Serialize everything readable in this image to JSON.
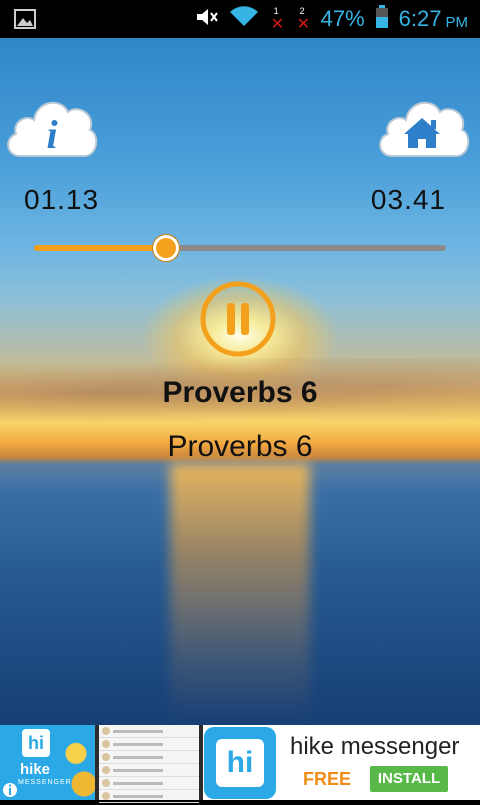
{
  "status_bar": {
    "sim1_label": "1",
    "sim2_label": "2",
    "battery": "47%",
    "time": "6:27",
    "ampm": "PM",
    "icons": [
      "image-icon",
      "mute-icon",
      "wifi-icon",
      "no-signal-icon",
      "no-signal-icon",
      "battery-icon"
    ]
  },
  "player": {
    "elapsed": "01.13",
    "total": "03.41",
    "progress_fraction": 0.318,
    "title_bold": "Proverbs 6",
    "title_sub": "Proverbs 6",
    "accent_color": "#f3a11d"
  },
  "ad": {
    "left_logo_hi": "hi",
    "left_logo_hike": "hike",
    "left_logo_messenger": "MESSENGER",
    "icon_hi": "hi",
    "title": "hike messenger",
    "free": "FREE",
    "install": "INSTALL"
  }
}
